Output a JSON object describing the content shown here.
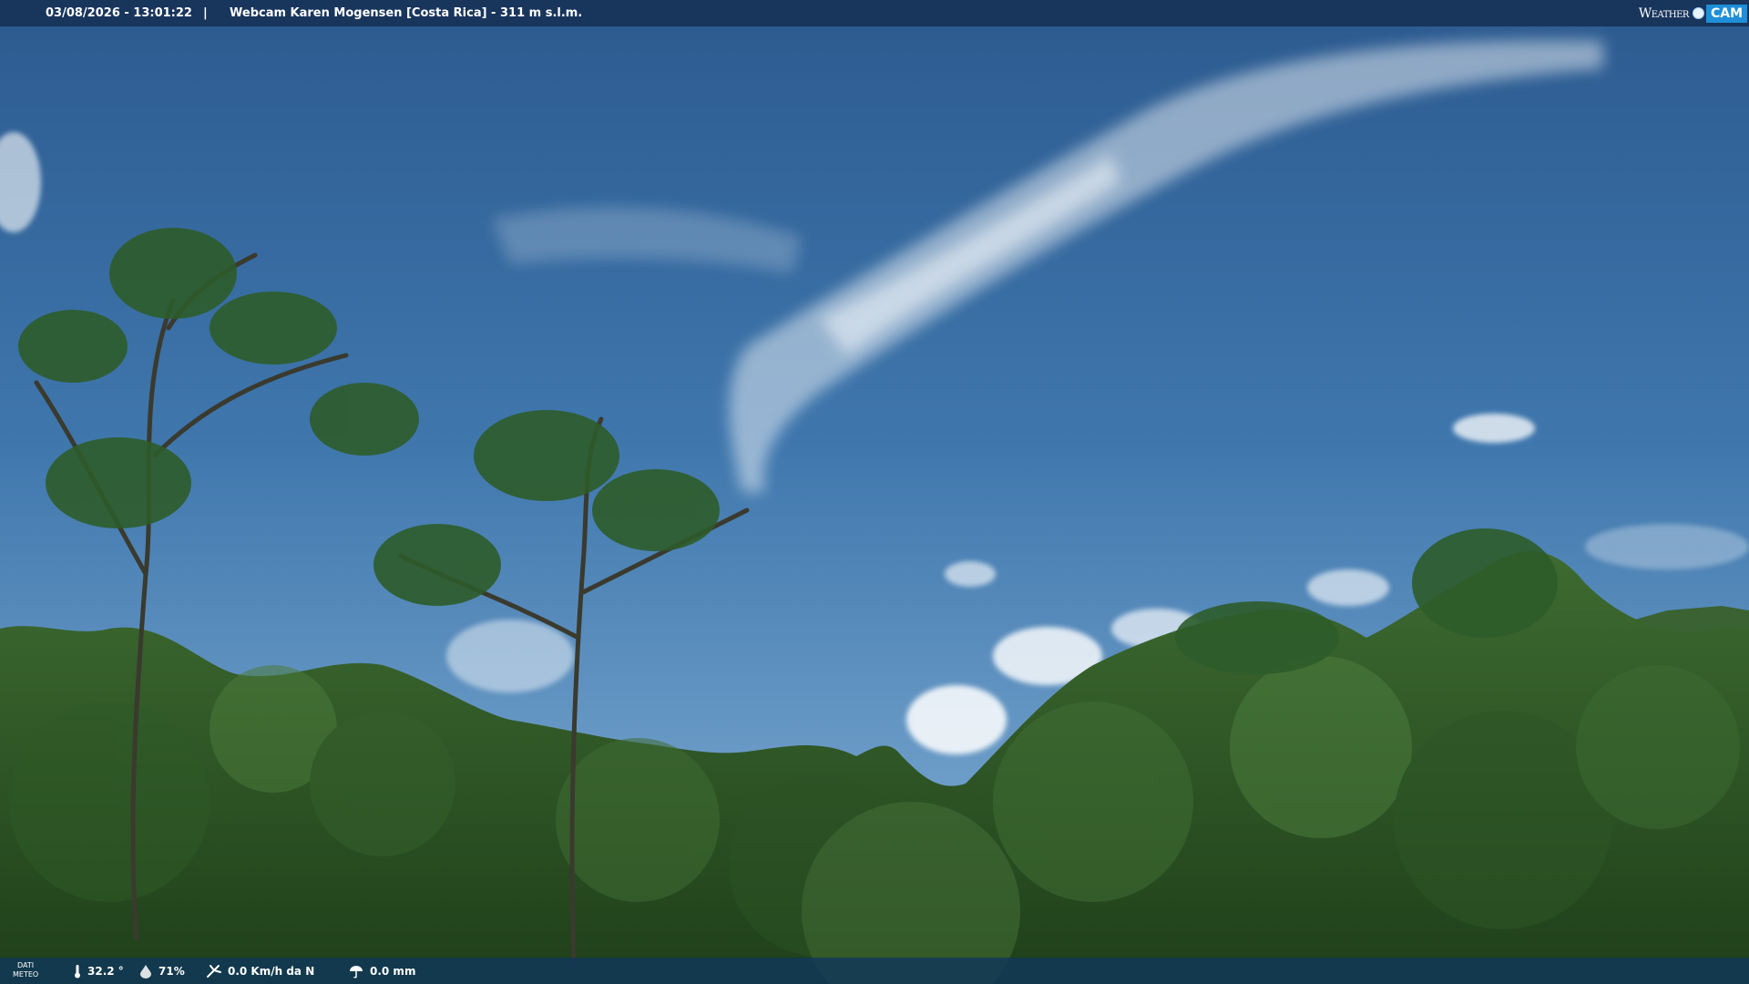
{
  "top_bar": {
    "datetime": "03/08/2026 - 13:01:22",
    "separator": "|",
    "location": "Webcam Karen Mogensen [Costa Rica] - 311 m s.l.m."
  },
  "logo": {
    "weather": "Weather",
    "cam": "CAM"
  },
  "bottom_bar": {
    "label_line1": "DATI",
    "label_line2": "METEO",
    "temperature": "32.2 °",
    "humidity": "71%",
    "wind": "0.0 Km/h da N",
    "rain": "0.0 mm"
  },
  "colors": {
    "sky_top": "#2f6096",
    "sky_bottom": "#7aa6cc",
    "forest": "#2f5a26",
    "overlay_bar": "#142d50",
    "logo_accent": "#1e8fd8"
  },
  "icons": {
    "temperature": "thermometer-icon",
    "humidity": "humidity-drop-icon",
    "wind": "wind-icon",
    "rain": "rain-gauge-icon"
  }
}
